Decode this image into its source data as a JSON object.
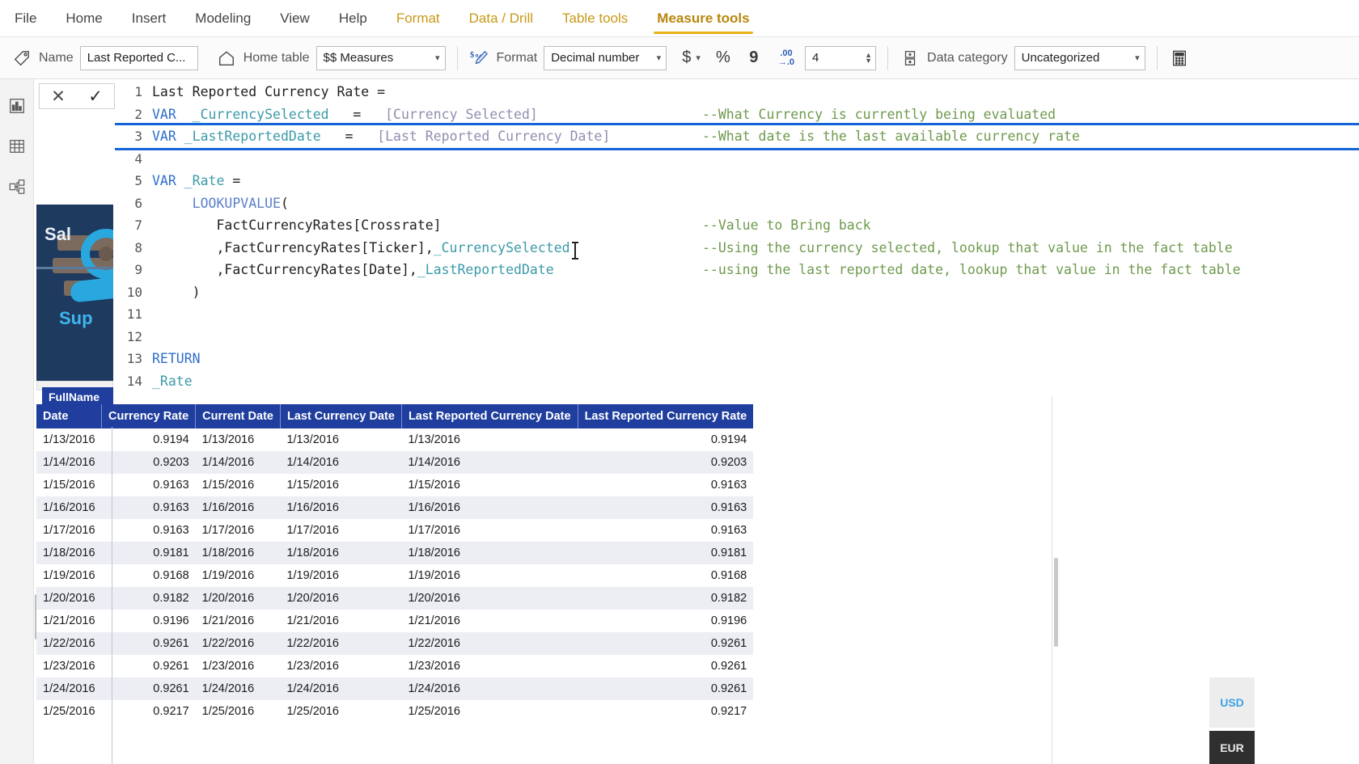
{
  "ribbon": {
    "tabs": [
      {
        "label": "File",
        "kind": "normal"
      },
      {
        "label": "Home",
        "kind": "normal"
      },
      {
        "label": "Insert",
        "kind": "normal"
      },
      {
        "label": "Modeling",
        "kind": "normal"
      },
      {
        "label": "View",
        "kind": "normal"
      },
      {
        "label": "Help",
        "kind": "normal"
      },
      {
        "label": "Format",
        "kind": "contextual"
      },
      {
        "label": "Data / Drill",
        "kind": "contextual"
      },
      {
        "label": "Table tools",
        "kind": "contextual"
      },
      {
        "label": "Measure tools",
        "kind": "active"
      }
    ]
  },
  "toolbar": {
    "name_label": "Name",
    "name_value": "Last Reported C...",
    "home_table_label": "Home table",
    "home_table_value": "$$ Measures",
    "format_label": "Format",
    "format_value": "Decimal number",
    "currency_glyph": "$",
    "percent_glyph": "%",
    "thousands_glyph": "9",
    "decimals_glyph": ".00",
    "decimals_glyph2": "→.0",
    "decimal_places_value": "4",
    "data_category_label": "Data category",
    "data_category_value": "Uncategorized"
  },
  "rail": {
    "items": [
      {
        "name": "report-view"
      },
      {
        "name": "data-view"
      },
      {
        "name": "model-view"
      }
    ]
  },
  "formula_bar": {
    "cancel_glyph": "✕",
    "commit_glyph": "✓"
  },
  "editor": {
    "lines": [
      {
        "number": "1",
        "highlighted": false,
        "segments": [
          {
            "t": "Last Reported Currency Rate =",
            "c": "tok-plain"
          }
        ],
        "comment": ""
      },
      {
        "number": "2",
        "highlighted": false,
        "segments": [
          {
            "t": "VAR ",
            "c": "tok-kw"
          },
          {
            "t": " _CurrencySelected",
            "c": "tok-var"
          },
          {
            "t": "   =   ",
            "c": "tok-plain"
          },
          {
            "t": "[Currency Selected]",
            "c": "tok-ref"
          }
        ],
        "comment": "--What Currency is currently being evaluated"
      },
      {
        "number": "3",
        "highlighted": true,
        "segments": [
          {
            "t": "VAR ",
            "c": "tok-kw"
          },
          {
            "t": "_LastReportedDate",
            "c": "tok-var"
          },
          {
            "t": "   =   ",
            "c": "tok-plain"
          },
          {
            "t": "[Last Reported Currency Date]",
            "c": "tok-ref"
          }
        ],
        "comment": "--What date is the last available currency rate"
      },
      {
        "number": "4",
        "highlighted": false,
        "segments": [
          {
            "t": "",
            "c": "tok-plain"
          }
        ],
        "comment": ""
      },
      {
        "number": "5",
        "highlighted": false,
        "segments": [
          {
            "t": "VAR ",
            "c": "tok-kw"
          },
          {
            "t": "_Rate",
            "c": "tok-var"
          },
          {
            "t": " =",
            "c": "tok-plain"
          }
        ],
        "comment": ""
      },
      {
        "number": "6",
        "highlighted": false,
        "segments": [
          {
            "t": "     ",
            "c": "tok-plain"
          },
          {
            "t": "LOOKUPVALUE",
            "c": "tok-fn"
          },
          {
            "t": "(",
            "c": "tok-plain"
          }
        ],
        "comment": ""
      },
      {
        "number": "7",
        "highlighted": false,
        "segments": [
          {
            "t": "        FactCurrencyRates[Crossrate]",
            "c": "tok-plain"
          }
        ],
        "comment": "--Value to Bring back"
      },
      {
        "number": "8",
        "highlighted": false,
        "segments": [
          {
            "t": "        ,FactCurrencyRates[Ticker],",
            "c": "tok-plain"
          },
          {
            "t": "_CurrencySelected",
            "c": "tok-var"
          }
        ],
        "comment": "--Using the currency selected, lookup that value in the fact table"
      },
      {
        "number": "9",
        "highlighted": false,
        "segments": [
          {
            "t": "        ,FactCurrencyRates[Date],",
            "c": "tok-plain"
          },
          {
            "t": "_LastReportedDate",
            "c": "tok-var"
          }
        ],
        "comment": "--using the last reported date, lookup that value in the fact table"
      },
      {
        "number": "10",
        "highlighted": false,
        "segments": [
          {
            "t": "     )",
            "c": "tok-plain"
          }
        ],
        "comment": ""
      },
      {
        "number": "11",
        "highlighted": false,
        "segments": [
          {
            "t": "",
            "c": "tok-plain"
          }
        ],
        "comment": ""
      },
      {
        "number": "12",
        "highlighted": false,
        "segments": [
          {
            "t": "",
            "c": "tok-plain"
          }
        ],
        "comment": ""
      },
      {
        "number": "13",
        "highlighted": false,
        "segments": [
          {
            "t": "RETURN",
            "c": "tok-kw"
          }
        ],
        "comment": ""
      },
      {
        "number": "14",
        "highlighted": false,
        "segments": [
          {
            "t": "_Rate",
            "c": "tok-var"
          }
        ],
        "comment": ""
      }
    ]
  },
  "viz_card": {
    "title_fragment": "Sal",
    "subtitle_fragment": "Sup"
  },
  "fullname_tag": {
    "label": "FullName"
  },
  "table": {
    "columns": [
      "Date",
      "Currency Rate",
      "Current Date",
      "Last Currency Date",
      "Last Reported Currency Date",
      "Last Reported Currency Rate"
    ],
    "rows": [
      [
        "1/13/2016",
        "0.9194",
        "1/13/2016",
        "1/13/2016",
        "1/13/2016",
        "0.9194"
      ],
      [
        "1/14/2016",
        "0.9203",
        "1/14/2016",
        "1/14/2016",
        "1/14/2016",
        "0.9203"
      ],
      [
        "1/15/2016",
        "0.9163",
        "1/15/2016",
        "1/15/2016",
        "1/15/2016",
        "0.9163"
      ],
      [
        "1/16/2016",
        "0.9163",
        "1/16/2016",
        "1/16/2016",
        "1/16/2016",
        "0.9163"
      ],
      [
        "1/17/2016",
        "0.9163",
        "1/17/2016",
        "1/17/2016",
        "1/17/2016",
        "0.9163"
      ],
      [
        "1/18/2016",
        "0.9181",
        "1/18/2016",
        "1/18/2016",
        "1/18/2016",
        "0.9181"
      ],
      [
        "1/19/2016",
        "0.9168",
        "1/19/2016",
        "1/19/2016",
        "1/19/2016",
        "0.9168"
      ],
      [
        "1/20/2016",
        "0.9182",
        "1/20/2016",
        "1/20/2016",
        "1/20/2016",
        "0.9182"
      ],
      [
        "1/21/2016",
        "0.9196",
        "1/21/2016",
        "1/21/2016",
        "1/21/2016",
        "0.9196"
      ],
      [
        "1/22/2016",
        "0.9261",
        "1/22/2016",
        "1/22/2016",
        "1/22/2016",
        "0.9261"
      ],
      [
        "1/23/2016",
        "0.9261",
        "1/23/2016",
        "1/23/2016",
        "1/23/2016",
        "0.9261"
      ],
      [
        "1/24/2016",
        "0.9261",
        "1/24/2016",
        "1/24/2016",
        "1/24/2016",
        "0.9261"
      ],
      [
        "1/25/2016",
        "0.9217",
        "1/25/2016",
        "1/25/2016",
        "1/25/2016",
        "0.9217"
      ]
    ]
  },
  "slicer": {
    "usd_label": "USD",
    "eur_label": "EUR"
  },
  "colors": {
    "accent_tab": "#e8b11c",
    "highlight_border": "#1565d8",
    "table_header": "#1f3e9e",
    "comment_green": "#6f9a4e",
    "variable_teal": "#3c9aa8",
    "keyword_blue": "#2e6fc9"
  }
}
